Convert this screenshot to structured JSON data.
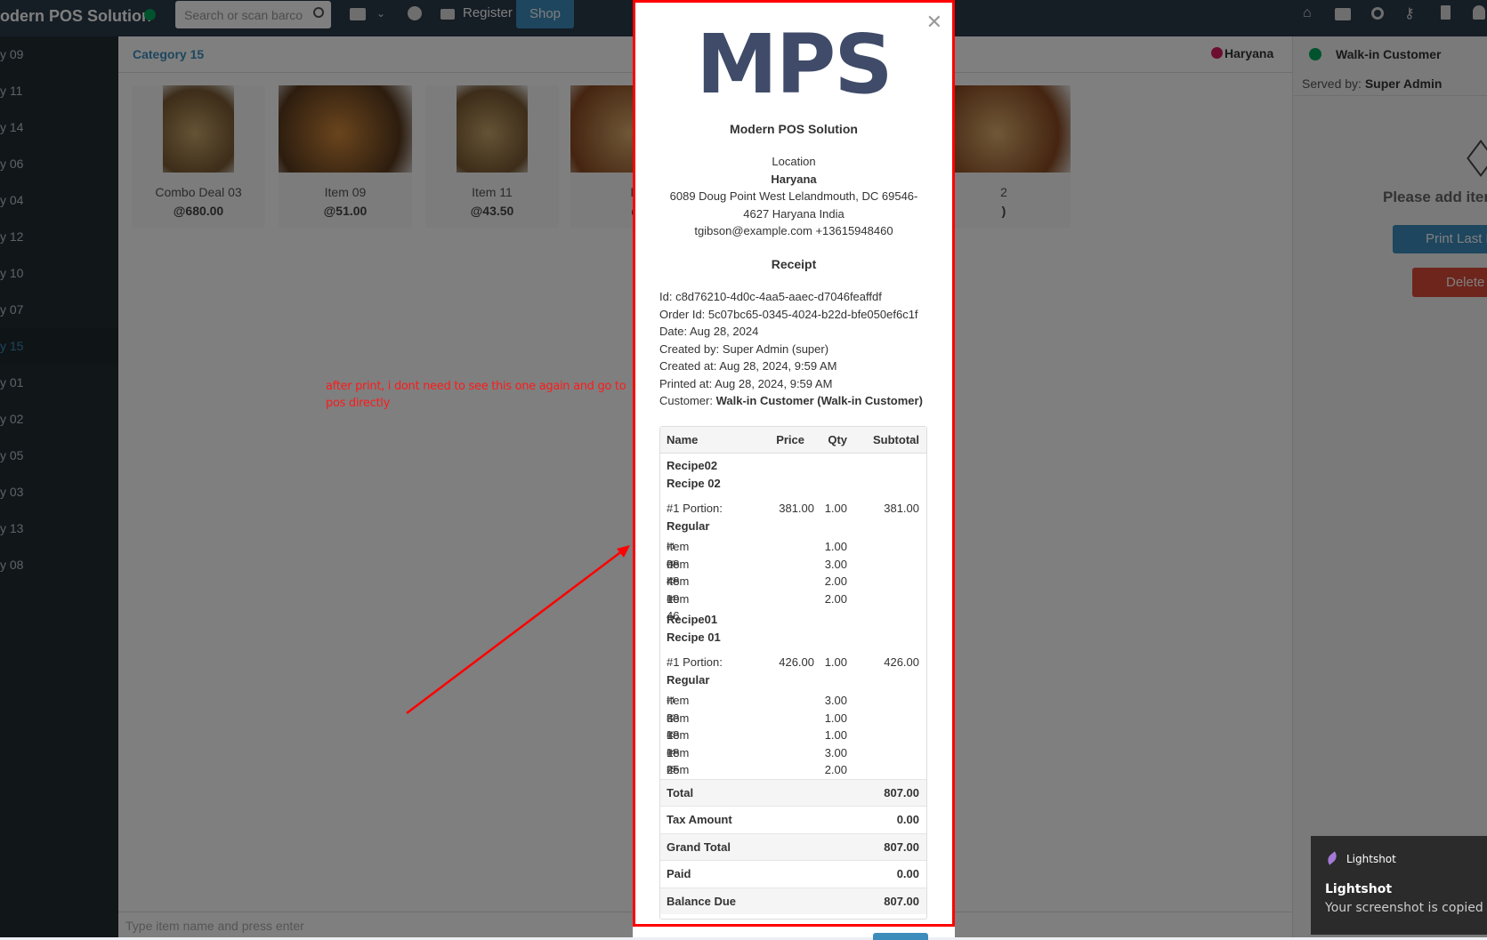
{
  "topbar": {
    "brand": "odern POS Solution",
    "search_placeholder": "Search or scan barco",
    "register": "Register",
    "shop": "Shop"
  },
  "sidebar": {
    "items": [
      "y 09",
      "y 11",
      "y 14",
      "y 06",
      "y 04",
      "y 12",
      "y 10",
      "y 07",
      "y 15",
      "y 01",
      "y 02",
      "y 05",
      "y 03",
      "y 13",
      "y 08"
    ],
    "active": "y 15"
  },
  "main": {
    "category_title": "Category 15",
    "location": "Haryana",
    "input_placeholder": "Type item name and press enter",
    "products": [
      {
        "name": "Combo Deal 03",
        "price": "@680.00"
      },
      {
        "name": "Item 09",
        "price": "@51.00"
      },
      {
        "name": "Item 11",
        "price": "@43.50"
      },
      {
        "name": "Ite",
        "price": "@"
      },
      {
        "name": "2",
        "price": ")"
      }
    ]
  },
  "right": {
    "customer": "Walk-in Customer",
    "served_label": "Served by:",
    "served_by": "Super Admin",
    "empty": "Please add iten",
    "print_last": "Print Last R",
    "delete": "Delete C"
  },
  "annotation": "after print, i dont need to see this one again and go to pos directly",
  "receipt": {
    "logo": "MPS",
    "business": "Modern POS Solution",
    "location_label": "Location",
    "location": "Haryana",
    "address1": "6089 Doug Point West Lelandmouth, DC 69546-",
    "address2": "4627 Haryana India",
    "contact": "tgibson@example.com +13615948460",
    "heading": "Receipt",
    "info": [
      "Id: c8d76210-4d0c-4aa5-aaec-d7046feaffdf",
      "Order Id: 5c07bc65-0345-4024-b22d-bfe050ef6c1f",
      "Date: Aug 28, 2024",
      "Created by: Super Admin (super)",
      "Created at: Aug 28, 2024, 9:59 AM",
      "Printed at: Aug 28, 2024, 9:59 AM"
    ],
    "customer_label": "Customer:",
    "customer": "Walk-in Customer (Walk-in Customer)",
    "columns": [
      "Name",
      "Price",
      "Qty",
      "Subtotal"
    ],
    "recipes": [
      {
        "code": "Recipe02",
        "name": "Recipe 02",
        "portion": "#1 Portion:",
        "portion_name": "Regular",
        "price": "381.00",
        "qty": "1.00",
        "subtotal": "381.00",
        "items": [
          {
            "n": "#1",
            "name": "Item 08",
            "qty": "1.00"
          },
          {
            "n": "#2",
            "name": "Item 48",
            "qty": "3.00"
          },
          {
            "n": "#3",
            "name": "Item 19",
            "qty": "2.00"
          },
          {
            "n": "#4",
            "name": "Item 46",
            "qty": "2.00"
          }
        ]
      },
      {
        "code": "Recipe01",
        "name": "Recipe 01",
        "portion": "#1 Portion:",
        "portion_name": "Regular",
        "price": "426.00",
        "qty": "1.00",
        "subtotal": "426.00",
        "items": [
          {
            "n": "#1",
            "name": "Item 33",
            "qty": "3.00"
          },
          {
            "n": "#2",
            "name": "Item 13",
            "qty": "1.00"
          },
          {
            "n": "#3",
            "name": "Item 18",
            "qty": "1.00"
          },
          {
            "n": "#4",
            "name": "Item 25",
            "qty": "3.00"
          },
          {
            "n": "#5",
            "name": "Item 29",
            "qty": "2.00"
          }
        ]
      }
    ],
    "summary": [
      {
        "label": "Total",
        "value": "807.00"
      },
      {
        "label": "Tax Amount",
        "value": "0.00"
      },
      {
        "label": "Grand Total",
        "value": "807.00"
      },
      {
        "label": "Paid",
        "value": "0.00"
      },
      {
        "label": "Balance Due",
        "value": "807.00"
      }
    ]
  },
  "toast": {
    "app": "Lightshot",
    "title": "Lightshot",
    "message": "Your screenshot is copied to"
  },
  "colors": {
    "accent": "#3c8dbc",
    "danger": "#dd4b39",
    "annotation": "#ff0000",
    "logo": "#3f4b69"
  }
}
